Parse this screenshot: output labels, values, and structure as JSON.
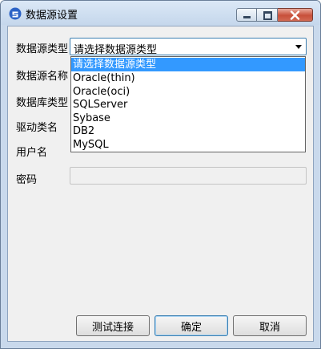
{
  "window": {
    "title": "数据源设置"
  },
  "form": {
    "labels": [
      "数据源类型",
      "数据源名称",
      "数据库类型",
      "驱动类名",
      "用户名",
      "密码"
    ],
    "datasource_type": {
      "selected": "请选择数据源类型",
      "options": [
        "请选择数据源类型",
        "Oracle(thin)",
        "Oracle(oci)",
        "SQLServer",
        "Sybase",
        "DB2",
        "MySQL"
      ]
    },
    "password_value": ""
  },
  "buttons": {
    "test": "测试连接",
    "ok": "确定",
    "cancel": "取消"
  },
  "colors": {
    "selection": "#3399ff",
    "dialog_bg": "#f0f0f0",
    "frame": "#c9d9ec"
  }
}
